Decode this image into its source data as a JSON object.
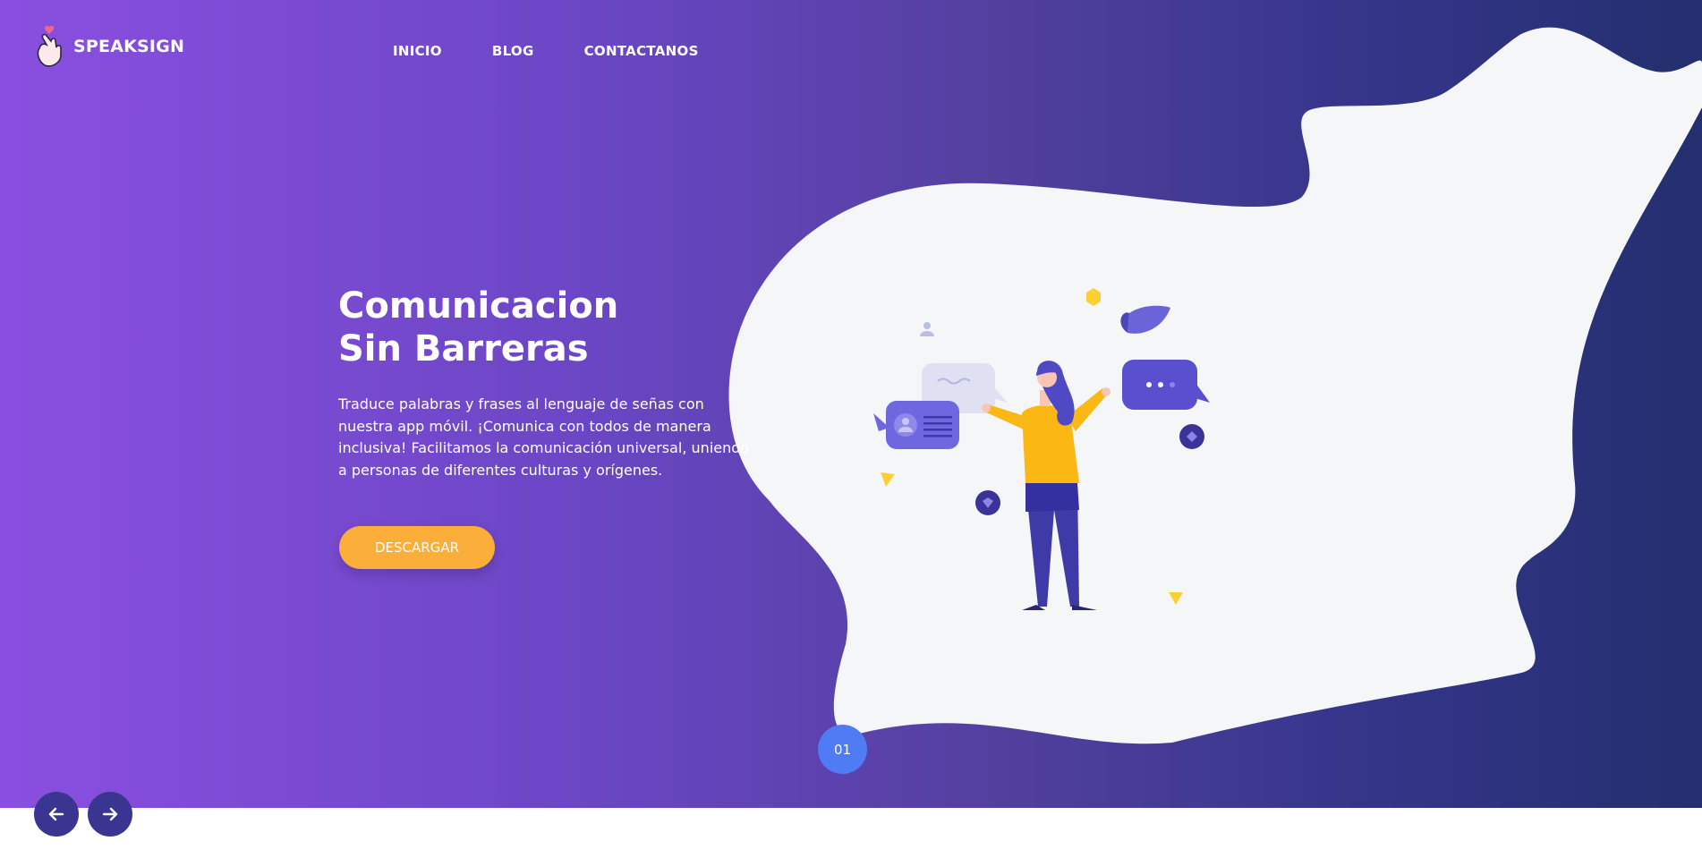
{
  "brand": {
    "name": "SPEAKSIGN",
    "logo_icon": "hand-heart-icon"
  },
  "nav": {
    "items": [
      "INICIO",
      "BLOG",
      "CONTACTANOS"
    ]
  },
  "hero": {
    "title_line1": "Comunicacion",
    "title_line2": "Sin Barreras",
    "description": "Traduce palabras y frases al lenguaje de señas con nuestra app móvil. ¡Comunica con todos de manera inclusiva! Facilitamos la comunicación universal, uniendo a personas de diferentes culturas y orígenes.",
    "cta_label": "DESCARGAR"
  },
  "slider": {
    "current": "01",
    "prev_icon": "arrow-left-icon",
    "next_icon": "arrow-right-icon"
  },
  "colors": {
    "gradient_start": "#8a4fe0",
    "gradient_end": "#232f6e",
    "cta": "#fcae3b",
    "slide_badge": "#4f7bf5",
    "arrow_bg": "#3a3591"
  }
}
